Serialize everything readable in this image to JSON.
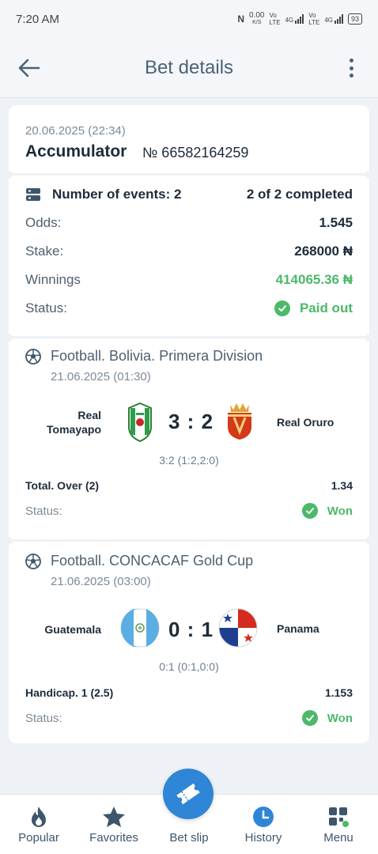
{
  "status_bar": {
    "time": "7:20 AM",
    "speed": "0.00",
    "speed_unit": "K/S",
    "net1": "Vo\nLTE",
    "net2": "4G",
    "net3": "Vo\nLTE",
    "net4": "4G",
    "battery": "93"
  },
  "header": {
    "title": "Bet details"
  },
  "bet": {
    "datetime": "20.06.2025 (22:34)",
    "type": "Accumulator",
    "number": "№ 66582164259",
    "events_label": "Number of events: 2",
    "completed": "2 of 2 completed",
    "odds_label": "Odds:",
    "odds_value": "1.545",
    "stake_label": "Stake:",
    "stake_value": "268000 ₦",
    "winnings_label": "Winnings",
    "winnings_value": "414065.36 ₦",
    "status_label": "Status:",
    "status_value": "Paid out"
  },
  "events": [
    {
      "league": "Football. Bolivia. Primera Division",
      "datetime": "21.06.2025 (01:30)",
      "team_home": "Real\nTomayapo",
      "team_away": "Real Oruro",
      "score": "3 : 2",
      "score_detail": "3:2 (1:2,2:0)",
      "pick": "Total. Over (2)",
      "odds": "1.34",
      "status_label": "Status:",
      "status_value": "Won"
    },
    {
      "league": "Football. CONCACAF Gold Cup",
      "datetime": "21.06.2025 (03:00)",
      "team_home": "Guatemala",
      "team_away": "Panama",
      "score": "0 : 1",
      "score_detail": "0:1 (0:1,0:0)",
      "pick": "Handicap. 1 (2.5)",
      "odds": "1.153",
      "status_label": "Status:",
      "status_value": "Won"
    }
  ],
  "nav": {
    "popular": "Popular",
    "favorites": "Favorites",
    "bet_slip": "Bet slip",
    "history": "History",
    "menu": "Menu"
  },
  "colors": {
    "accent": "#2f86d6",
    "success": "#4cb96a",
    "text": "#1d2b3a",
    "header_text": "#4a6277"
  }
}
